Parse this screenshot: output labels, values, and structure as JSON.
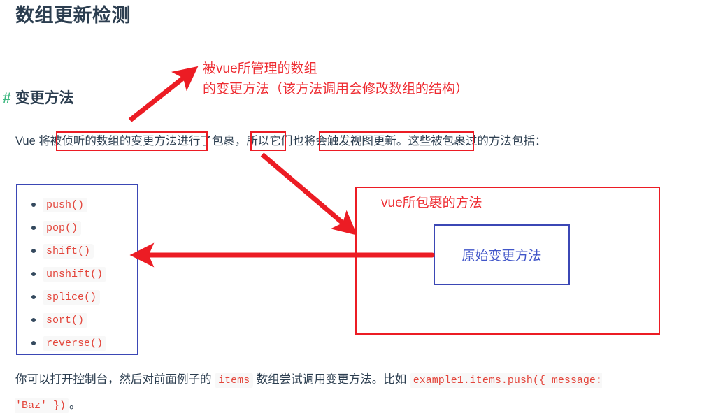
{
  "document": {
    "title": "数组更新检测",
    "section": {
      "anchor": "#",
      "heading": "变更方法"
    },
    "paragraph_main": {
      "seg_1": "Vue 将",
      "seg_2_boxed": "被侦听的数组的变更方法",
      "seg_3": "进行了",
      "seg_4_boxed": "包裹，",
      "seg_5": "所以",
      "seg_6_boxed": "它们也将会触发视图更新",
      "seg_7": "。这些被包裹过的方法包括："
    },
    "methods": [
      "push()",
      "pop()",
      "shift()",
      "unshift()",
      "splice()",
      "sort()",
      "reverse()"
    ],
    "paragraph_bottom": {
      "seg_1": "你可以打开控制台，然后对前面例子的",
      "code_1": "items",
      "seg_2": "数组尝试调用变更方法。比如",
      "code_2": "example1.items.push({ message: 'Baz' })",
      "seg_3": "。"
    }
  },
  "annotations": {
    "top_note_line1": "被vue所管理的数组",
    "top_note_line2": "的变更方法（该方法调用会修改数组的结构）",
    "red_box_label": "vue所包裹的方法",
    "blue_box_label": "原始变更方法"
  },
  "colors": {
    "annotation_red": "#ee2b31",
    "box_red": "#ec1c24",
    "box_blue": "#3b47b5",
    "label_blue": "#4156c9",
    "anchor_green": "#42b983",
    "code_red": "#e3453b",
    "text": "#2c3e50"
  }
}
